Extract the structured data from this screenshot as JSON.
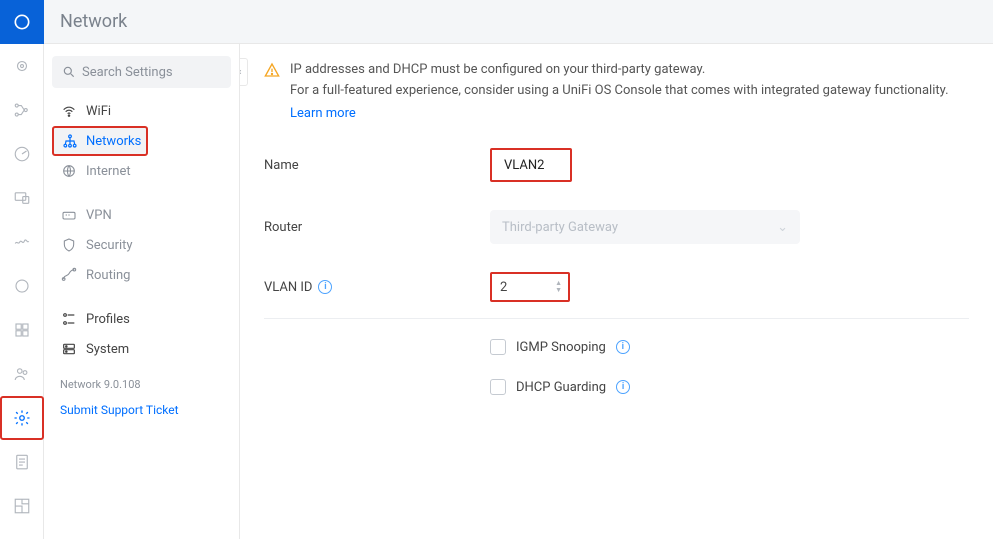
{
  "header": {
    "title": "Network"
  },
  "sidebar": {
    "search_placeholder": "Search Settings",
    "items": {
      "wifi": "WiFi",
      "networks": "Networks",
      "internet": "Internet",
      "vpn": "VPN",
      "security": "Security",
      "routing": "Routing",
      "profiles": "Profiles",
      "system": "System"
    },
    "version": "Network 9.0.108",
    "support_link": "Submit Support Ticket"
  },
  "notice": {
    "line1": "IP addresses and DHCP must be configured on your third-party gateway.",
    "line2": "For a full-featured experience, consider using a UniFi OS Console that comes with integrated gateway functionality.",
    "learn_more": "Learn more"
  },
  "form": {
    "name_label": "Name",
    "name_value": "VLAN2",
    "router_label": "Router",
    "router_value": "Third-party Gateway",
    "vlan_label": "VLAN ID",
    "vlan_value": "2",
    "igmp_label": "IGMP Snooping",
    "dhcp_label": "DHCP Guarding"
  }
}
